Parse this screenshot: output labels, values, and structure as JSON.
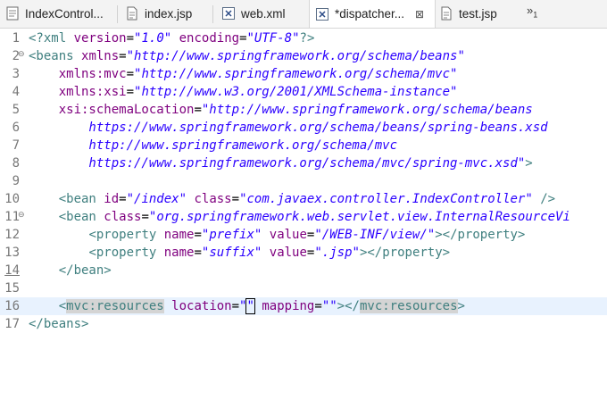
{
  "tabs": [
    {
      "label": "IndexControl...",
      "icon": "java-class-icon",
      "active": false,
      "closable": false
    },
    {
      "label": "index.jsp",
      "icon": "jsp-file-icon",
      "active": false,
      "closable": false
    },
    {
      "label": "web.xml",
      "icon": "xml-file-icon",
      "active": false,
      "closable": false
    },
    {
      "label": "*dispatcher...",
      "icon": "xml-file-icon",
      "active": true,
      "closable": true
    },
    {
      "label": "test.jsp",
      "icon": "jsp-file-icon",
      "active": false,
      "closable": false
    }
  ],
  "overflow": {
    "symbol": "»",
    "count": "1"
  },
  "editor": {
    "current_line": 16,
    "line_numbers": [
      "1",
      "2",
      "3",
      "4",
      "5",
      "6",
      "7",
      "8",
      "9",
      "10",
      "11",
      "12",
      "13",
      "14",
      "15",
      "16",
      "17"
    ],
    "folds": {
      "2": "⊖",
      "11": "⊖"
    },
    "lines": {
      "l1": [
        [
          "pi",
          "<?xml "
        ],
        [
          "attr",
          "version"
        ],
        [
          "txt",
          "="
        ],
        [
          "str",
          "\"1.0\""
        ],
        [
          "txt",
          " "
        ],
        [
          "attr",
          "encoding"
        ],
        [
          "txt",
          "="
        ],
        [
          "str",
          "\"UTF-8\""
        ],
        [
          "pi",
          "?>"
        ]
      ],
      "l2": [
        [
          "tag",
          "<beans "
        ],
        [
          "attr",
          "xmlns"
        ],
        [
          "txt",
          "="
        ],
        [
          "str",
          "\"http://www.springframework.org/schema/beans\""
        ]
      ],
      "l3": [
        [
          "txt",
          "    "
        ],
        [
          "attr",
          "xmlns:mvc"
        ],
        [
          "txt",
          "="
        ],
        [
          "str",
          "\"http://www.springframework.org/schema/mvc\""
        ]
      ],
      "l4": [
        [
          "txt",
          "    "
        ],
        [
          "attr",
          "xmlns:xsi"
        ],
        [
          "txt",
          "="
        ],
        [
          "str",
          "\"http://www.w3.org/2001/XMLSchema-instance\""
        ]
      ],
      "l5": [
        [
          "txt",
          "    "
        ],
        [
          "attr",
          "xsi:schemaLocation"
        ],
        [
          "txt",
          "="
        ],
        [
          "str",
          "\"http://www.springframework.org/schema/beans"
        ]
      ],
      "l6": [
        [
          "str",
          "        https://www.springframework.org/schema/beans/spring-beans.xsd"
        ]
      ],
      "l7": [
        [
          "str",
          "        http://www.springframework.org/schema/mvc"
        ]
      ],
      "l8": [
        [
          "str",
          "        https://www.springframework.org/schema/mvc/spring-mvc.xsd\""
        ],
        [
          "tag",
          ">"
        ]
      ],
      "l9": [],
      "l10": [
        [
          "txt",
          "    "
        ],
        [
          "tag",
          "<bean "
        ],
        [
          "attr",
          "id"
        ],
        [
          "txt",
          "="
        ],
        [
          "str",
          "\"/index\""
        ],
        [
          "txt",
          " "
        ],
        [
          "attr",
          "class"
        ],
        [
          "txt",
          "="
        ],
        [
          "str",
          "\"com.javaex.controller.IndexController\""
        ],
        [
          "txt",
          " "
        ],
        [
          "tag",
          "/>"
        ]
      ],
      "l11": [
        [
          "txt",
          "    "
        ],
        [
          "tag",
          "<bean "
        ],
        [
          "attr",
          "class"
        ],
        [
          "txt",
          "="
        ],
        [
          "str",
          "\"org.springframework.web.servlet.view.InternalResourceVi"
        ]
      ],
      "l12": [
        [
          "txt",
          "        "
        ],
        [
          "tag",
          "<property "
        ],
        [
          "attr",
          "name"
        ],
        [
          "txt",
          "="
        ],
        [
          "str",
          "\"prefix\""
        ],
        [
          "txt",
          " "
        ],
        [
          "attr",
          "value"
        ],
        [
          "txt",
          "="
        ],
        [
          "str",
          "\"/WEB-INF/view/\""
        ],
        [
          "tag",
          "></property>"
        ]
      ],
      "l13": [
        [
          "txt",
          "        "
        ],
        [
          "tag",
          "<property "
        ],
        [
          "attr",
          "name"
        ],
        [
          "txt",
          "="
        ],
        [
          "str",
          "\"suffix\""
        ],
        [
          "txt",
          " "
        ],
        [
          "attr",
          "value"
        ],
        [
          "txt",
          "="
        ],
        [
          "str",
          "\".jsp\""
        ],
        [
          "tag",
          "></property>"
        ]
      ],
      "l14": [
        [
          "txt",
          "    "
        ],
        [
          "tag",
          "</bean>"
        ]
      ],
      "l15": [],
      "l16": [
        [
          "txt",
          "    "
        ],
        [
          "tag",
          "<"
        ],
        [
          "tagocc",
          "mvc:resources"
        ],
        [
          "txt",
          " "
        ],
        [
          "attr",
          "location"
        ],
        [
          "txt",
          "="
        ],
        [
          "str",
          "\""
        ],
        [
          "caret",
          "\""
        ],
        [
          "txt",
          " "
        ],
        [
          "attr",
          "mapping"
        ],
        [
          "txt",
          "="
        ],
        [
          "str",
          "\"\""
        ],
        [
          "tag",
          "></"
        ],
        [
          "tagocc",
          "mvc:resources"
        ],
        [
          "tag",
          ">"
        ]
      ],
      "l17": [
        [
          "tag",
          "</beans>"
        ]
      ]
    }
  },
  "colors": {
    "tag": "#3f7f7f",
    "attr": "#7f007f",
    "string": "#2a00ff",
    "current_line_bg": "#e8f2fe"
  }
}
